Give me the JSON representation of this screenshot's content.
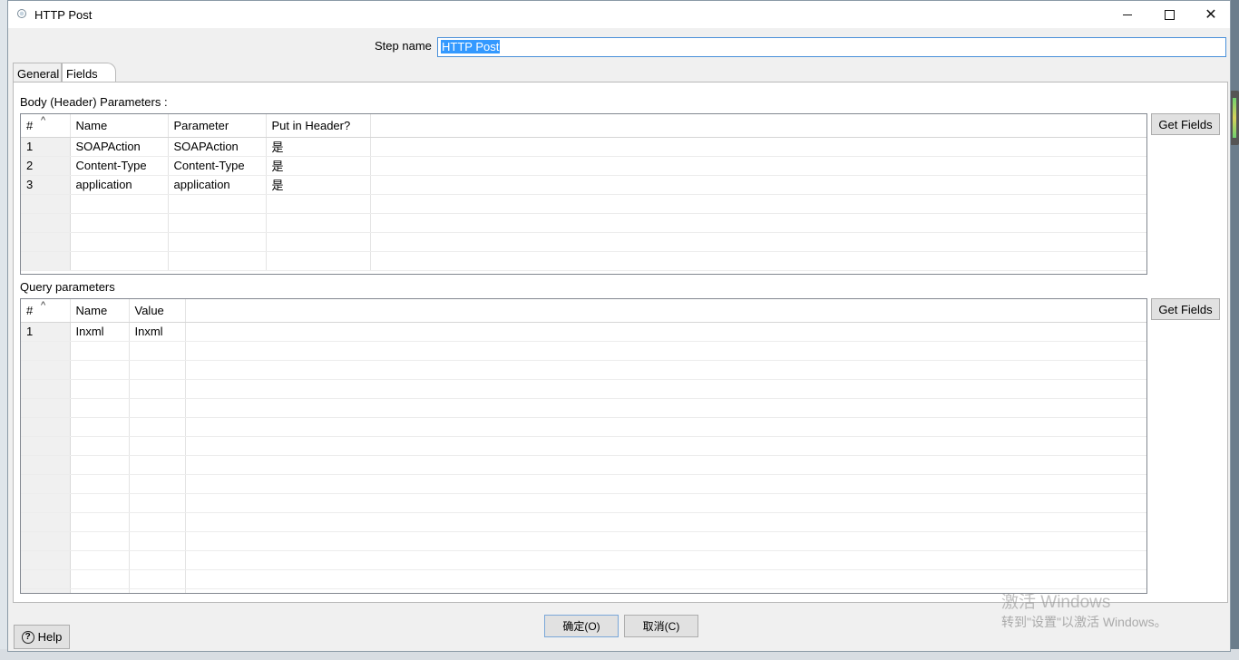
{
  "window": {
    "title": "HTTP Post"
  },
  "step": {
    "label": "Step name",
    "value": "HTTP Post"
  },
  "tabs": [
    {
      "label": "General"
    },
    {
      "label": "Fields"
    }
  ],
  "body_params": {
    "label": "Body (Header) Parameters :",
    "columns": [
      "#",
      "Name",
      "Parameter",
      "Put in Header?"
    ],
    "rows": [
      [
        "1",
        "SOAPAction",
        "SOAPAction",
        "是"
      ],
      [
        "2",
        "Content-Type",
        "Content-Type",
        "是"
      ],
      [
        "3",
        "application",
        "application",
        "是"
      ]
    ],
    "get_fields_label": "Get Fields"
  },
  "query_params": {
    "label": "Query parameters",
    "columns": [
      "#",
      "Name",
      "Value"
    ],
    "rows": [
      [
        "1",
        "Inxml",
        "Inxml"
      ]
    ],
    "get_fields_label": "Get Fields"
  },
  "footer": {
    "help_label": "Help",
    "ok_label": "确定(O)",
    "cancel_label": "取消(C)"
  },
  "watermark": {
    "line1": "激活 Windows",
    "line2": "转到\"设置\"以激活 Windows。"
  }
}
